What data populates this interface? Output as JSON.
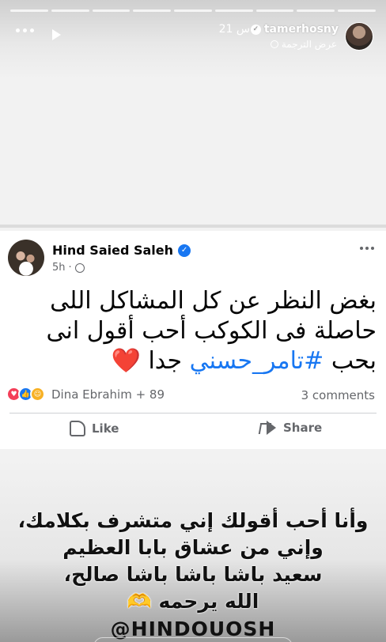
{
  "story": {
    "username": "tamerhosny",
    "time": "21 س",
    "translate": "عرض الترجمة",
    "segments": 9,
    "more_icon": "more-dots-icon",
    "play_icon": "play-icon"
  },
  "post": {
    "author": "Hind Saied Saleh",
    "time": "5h",
    "privacy_icon": "globe-icon",
    "text_line1": "بغض النظر عن كل المشاكل اللى",
    "text_line2": "حاصلة فى الكوكب أحب أقول انى",
    "text_line3_start": "بحب",
    "hashtag": "#تامر_حسني",
    "text_line3_end": "جدا",
    "emoji_heart": "❤️",
    "reactions_text": "Dina Ebrahim + 89",
    "comments": "3 comments",
    "like_label": "Like",
    "share_label": "Share"
  },
  "caption": {
    "line1": "وأنا أحب أقولك إني متشرف بكلامك،",
    "line2": "وإني من عشاق بابا العظيم",
    "line3": "سعيد باشا باشا باشا صالح،",
    "line4": "الله يرحمه 🫶",
    "handle": "@HINDOUOSH"
  },
  "colors": {
    "facebook_blue": "#1877f2",
    "love_red": "#f33e58",
    "secondary_text": "#65676b"
  }
}
